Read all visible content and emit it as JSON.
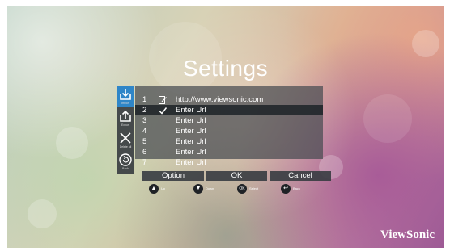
{
  "title": "Settings",
  "sidebar": {
    "items": [
      {
        "icon": "import-icon",
        "label": "Import",
        "active": true
      },
      {
        "icon": "export-icon",
        "label": "Export",
        "active": false
      },
      {
        "icon": "delete-all-icon",
        "label": "Delete all",
        "active": false
      },
      {
        "icon": "back-icon",
        "label": "Back",
        "active": false
      }
    ]
  },
  "url_list": [
    {
      "num": "1",
      "mark": "edit",
      "url": "http://www.viewsonic.com"
    },
    {
      "num": "2",
      "mark": "check",
      "url": "Enter Url"
    },
    {
      "num": "3",
      "mark": "",
      "url": "Enter Url"
    },
    {
      "num": "4",
      "mark": "",
      "url": "Enter Url"
    },
    {
      "num": "5",
      "mark": "",
      "url": "Enter Url"
    },
    {
      "num": "6",
      "mark": "",
      "url": "Enter Url"
    },
    {
      "num": "7",
      "mark": "",
      "url": "Enter Url"
    }
  ],
  "selected_row": 2,
  "buttons": {
    "option": "Option",
    "ok": "OK",
    "cancel": "Cancel"
  },
  "hints": [
    {
      "icon": "up-arrow-icon",
      "key": "▲",
      "label": "Up"
    },
    {
      "icon": "down-arrow-icon",
      "key": "▼",
      "label": "Down"
    },
    {
      "icon": "ok-key-icon",
      "key": "OK",
      "label": "Select"
    },
    {
      "icon": "return-icon",
      "key": "↩",
      "label": "Back"
    }
  ],
  "brand": "ViewSonic",
  "colors": {
    "active_tab": "#2f86c8",
    "panel": "#464b50",
    "selected_row": "#23282d"
  }
}
